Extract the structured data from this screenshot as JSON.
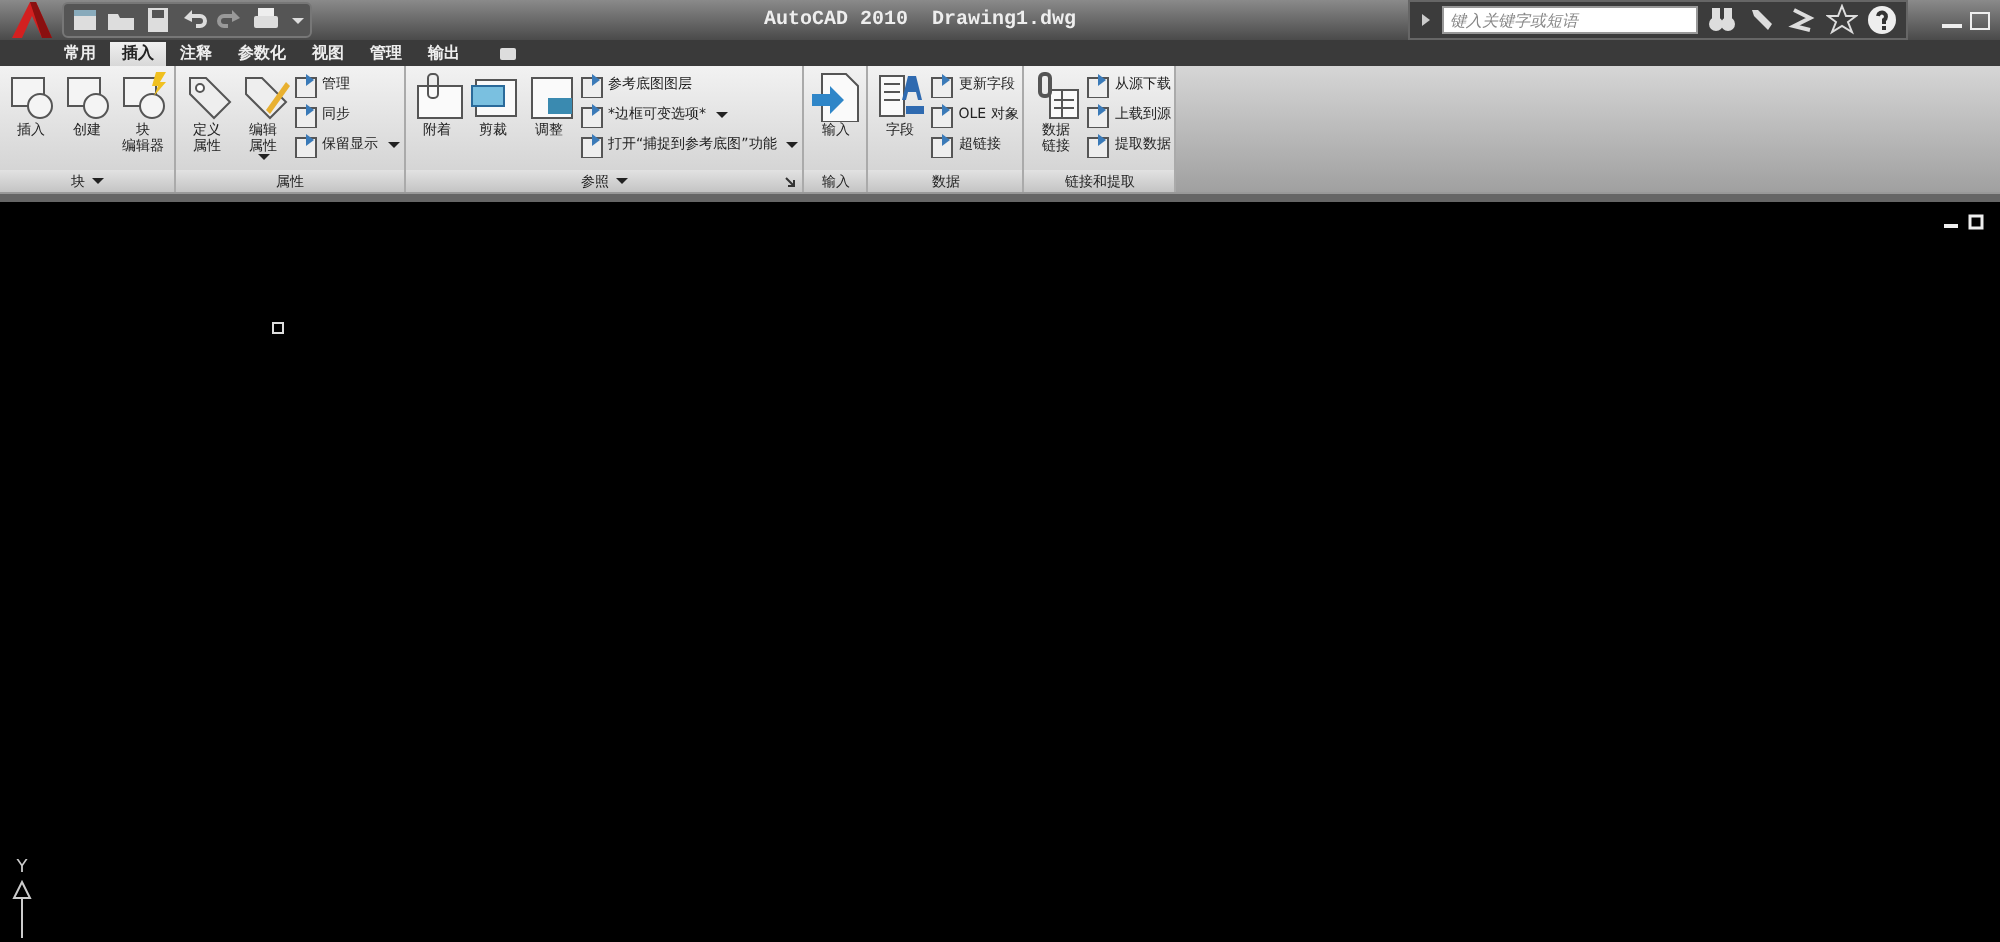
{
  "title_bar": {
    "title": "AutoCAD 2010  Drawing1.dwg",
    "search": {
      "placeholder": "键入关键字或短语"
    }
  },
  "tabs": [
    {
      "label": "常用",
      "selected": false
    },
    {
      "label": "插入",
      "selected": true
    },
    {
      "label": "注释",
      "selected": false
    },
    {
      "label": "参数化",
      "selected": false
    },
    {
      "label": "视图",
      "selected": false
    },
    {
      "label": "管理",
      "selected": false
    },
    {
      "label": "输出",
      "selected": false
    }
  ],
  "panels": [
    {
      "title": "块",
      "dropdown": true,
      "launcher": false,
      "large": [
        {
          "lines": [
            "插入"
          ],
          "kind": "block",
          "dropdown": false
        },
        {
          "lines": [
            "创建"
          ],
          "kind": "block",
          "dropdown": false
        },
        {
          "lines": [
            "块",
            "编辑器"
          ],
          "kind": "block-edit",
          "dropdown": false
        }
      ]
    },
    {
      "title": "属性",
      "dropdown": false,
      "launcher": false,
      "large": [
        {
          "lines": [
            "定义",
            "属性"
          ],
          "kind": "tag",
          "dropdown": false
        },
        {
          "lines": [
            "编辑",
            "属性"
          ],
          "kind": "tag-edit",
          "dropdown": true
        }
      ],
      "small": [
        {
          "label": "管理",
          "dropdown": false
        },
        {
          "label": "同步",
          "dropdown": false
        },
        {
          "label": "保留显示",
          "dropdown": true
        }
      ]
    },
    {
      "title": "参照",
      "dropdown": true,
      "launcher": true,
      "large": [
        {
          "lines": [
            "附着"
          ],
          "kind": "clip",
          "dropdown": false
        },
        {
          "lines": [
            "剪裁"
          ],
          "kind": "frame",
          "dropdown": false
        },
        {
          "lines": [
            "调整"
          ],
          "kind": "adjust",
          "dropdown": false
        }
      ],
      "small": [
        {
          "label": "参考底图图层",
          "dropdown": false
        },
        {
          "label": "*边框可变选项*",
          "dropdown": true
        },
        {
          "label": "打开“捕捉到参考底图”功能",
          "dropdown": true
        }
      ]
    },
    {
      "title": "输入",
      "dropdown": false,
      "launcher": false,
      "large": [
        {
          "lines": [
            "输入"
          ],
          "kind": "import",
          "dropdown": false
        }
      ]
    },
    {
      "title": "数据",
      "dropdown": false,
      "launcher": false,
      "large": [
        {
          "lines": [
            "字段"
          ],
          "kind": "field",
          "dropdown": false
        }
      ],
      "small": [
        {
          "label": "更新字段",
          "dropdown": false
        },
        {
          "label": "OLE 对象",
          "dropdown": false
        },
        {
          "label": "超链接",
          "dropdown": false
        }
      ]
    },
    {
      "title": "链接和提取",
      "dropdown": false,
      "launcher": false,
      "large": [
        {
          "lines": [
            "数据",
            "链接"
          ],
          "kind": "link",
          "dropdown": false
        }
      ],
      "small": [
        {
          "label": "从源下载",
          "dropdown": false
        },
        {
          "label": "上载到源",
          "dropdown": false
        },
        {
          "label": "提取数据",
          "dropdown": false
        }
      ]
    }
  ],
  "canvas": {
    "axis_label": "Y"
  }
}
